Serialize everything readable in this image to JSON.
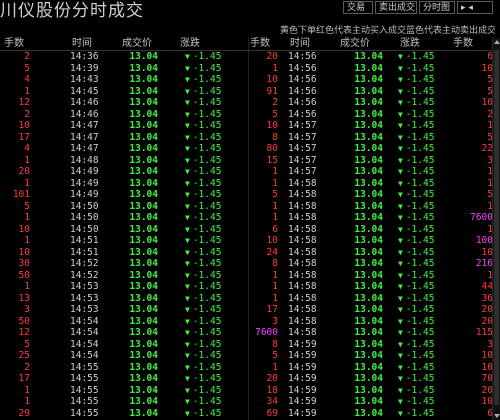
{
  "title": "川仪股份分时成交",
  "toolbar": {
    "btn1": "交易",
    "btn2": "卖出成交",
    "btn3": "分时图",
    "btn4": ""
  },
  "legend": "黄色下单红色代表主动买入成交蓝色代表主动卖出成交粉色为大单",
  "headers": {
    "left": [
      "手数",
      "时间",
      "成交价",
      "涨跌"
    ],
    "right": [
      "手数",
      "时间",
      "成交价",
      "涨跌",
      "手数"
    ]
  },
  "colors": {
    "up": "#ff3b3b",
    "down": "#3ff23f",
    "big": "#ff3bff",
    "bg": "#000000"
  },
  "left_rows": [
    {
      "vol": "2",
      "vc": "red",
      "time": "14:36",
      "price": "13.04",
      "chg": "-1.45"
    },
    {
      "vol": "5",
      "vc": "red",
      "time": "14:39",
      "price": "13.04",
      "chg": "-1.45"
    },
    {
      "vol": "4",
      "vc": "red",
      "time": "14:43",
      "price": "13.04",
      "chg": "-1.45"
    },
    {
      "vol": "1",
      "vc": "red",
      "time": "14:45",
      "price": "13.04",
      "chg": "-1.45"
    },
    {
      "vol": "12",
      "vc": "red",
      "time": "14:46",
      "price": "13.04",
      "chg": "-1.45"
    },
    {
      "vol": "2",
      "vc": "red",
      "time": "14:46",
      "price": "13.04",
      "chg": "-1.45"
    },
    {
      "vol": "10",
      "vc": "red",
      "time": "14:47",
      "price": "13.04",
      "chg": "-1.45"
    },
    {
      "vol": "17",
      "vc": "red",
      "time": "14:47",
      "price": "13.04",
      "chg": "-1.45"
    },
    {
      "vol": "4",
      "vc": "red",
      "time": "14:47",
      "price": "13.04",
      "chg": "-1.45"
    },
    {
      "vol": "1",
      "vc": "red",
      "time": "14:48",
      "price": "13.04",
      "chg": "-1.45"
    },
    {
      "vol": "20",
      "vc": "red",
      "time": "14:49",
      "price": "13.04",
      "chg": "-1.45"
    },
    {
      "vol": "1",
      "vc": "red",
      "time": "14:49",
      "price": "13.04",
      "chg": "-1.45"
    },
    {
      "vol": "101",
      "vc": "red",
      "time": "14:49",
      "price": "13.04",
      "chg": "-1.45"
    },
    {
      "vol": "5",
      "vc": "red",
      "time": "14:50",
      "price": "13.04",
      "chg": "-1.45"
    },
    {
      "vol": "1",
      "vc": "red",
      "time": "14:50",
      "price": "13.04",
      "chg": "-1.45"
    },
    {
      "vol": "10",
      "vc": "red",
      "time": "14:50",
      "price": "13.04",
      "chg": "-1.45"
    },
    {
      "vol": "1",
      "vc": "red",
      "time": "14:51",
      "price": "13.04",
      "chg": "-1.45"
    },
    {
      "vol": "10",
      "vc": "red",
      "time": "14:51",
      "price": "13.04",
      "chg": "-1.45"
    },
    {
      "vol": "30",
      "vc": "red",
      "time": "14:52",
      "price": "13.04",
      "chg": "-1.45"
    },
    {
      "vol": "50",
      "vc": "red",
      "time": "14:52",
      "price": "13.04",
      "chg": "-1.45"
    },
    {
      "vol": "1",
      "vc": "red",
      "time": "14:53",
      "price": "13.04",
      "chg": "-1.45"
    },
    {
      "vol": "13",
      "vc": "red",
      "time": "14:53",
      "price": "13.04",
      "chg": "-1.45"
    },
    {
      "vol": "3",
      "vc": "red",
      "time": "14:53",
      "price": "13.04",
      "chg": "-1.45"
    },
    {
      "vol": "50",
      "vc": "red",
      "time": "14:54",
      "price": "13.04",
      "chg": "-1.45"
    },
    {
      "vol": "12",
      "vc": "red",
      "time": "14:54",
      "price": "13.04",
      "chg": "-1.45"
    },
    {
      "vol": "5",
      "vc": "red",
      "time": "14:54",
      "price": "13.04",
      "chg": "-1.45"
    },
    {
      "vol": "25",
      "vc": "red",
      "time": "14:54",
      "price": "13.04",
      "chg": "-1.45"
    },
    {
      "vol": "2",
      "vc": "red",
      "time": "14:55",
      "price": "13.04",
      "chg": "-1.45"
    },
    {
      "vol": "17",
      "vc": "red",
      "time": "14:55",
      "price": "13.04",
      "chg": "-1.45"
    },
    {
      "vol": "1",
      "vc": "red",
      "time": "14:55",
      "price": "13.04",
      "chg": "-1.45"
    },
    {
      "vol": "1",
      "vc": "red",
      "time": "14:55",
      "price": "13.04",
      "chg": "-1.45"
    },
    {
      "vol": "29",
      "vc": "red",
      "time": "14:55",
      "price": "13.04",
      "chg": "-1.45"
    }
  ],
  "right_rows": [
    {
      "n": "20",
      "nc": "red",
      "time": "14:56",
      "price": "13.04",
      "chg": "-1.45",
      "vol": "6",
      "vc": "red"
    },
    {
      "n": "1",
      "nc": "red",
      "time": "14:56",
      "price": "13.04",
      "chg": "-1.45",
      "vol": "10",
      "vc": "red"
    },
    {
      "n": "10",
      "nc": "red",
      "time": "14:56",
      "price": "13.04",
      "chg": "-1.45",
      "vol": "5",
      "vc": "red"
    },
    {
      "n": "91",
      "nc": "red",
      "time": "14:56",
      "price": "13.04",
      "chg": "-1.45",
      "vol": "5",
      "vc": "red"
    },
    {
      "n": "2",
      "nc": "red",
      "time": "14:56",
      "price": "13.04",
      "chg": "-1.45",
      "vol": "10",
      "vc": "red"
    },
    {
      "n": "5",
      "nc": "red",
      "time": "14:56",
      "price": "13.04",
      "chg": "-1.45",
      "vol": "2",
      "vc": "red"
    },
    {
      "n": "10",
      "nc": "red",
      "time": "14:57",
      "price": "13.04",
      "chg": "-1.45",
      "vol": "1",
      "vc": "red"
    },
    {
      "n": "8",
      "nc": "red",
      "time": "14:57",
      "price": "13.04",
      "chg": "-1.45",
      "vol": "5",
      "vc": "red"
    },
    {
      "n": "80",
      "nc": "red",
      "time": "14:57",
      "price": "13.04",
      "chg": "-1.45",
      "vol": "22",
      "vc": "red"
    },
    {
      "n": "15",
      "nc": "red",
      "time": "14:57",
      "price": "13.04",
      "chg": "-1.45",
      "vol": "3",
      "vc": "red"
    },
    {
      "n": "1",
      "nc": "red",
      "time": "14:57",
      "price": "13.04",
      "chg": "-1.45",
      "vol": "1",
      "vc": "red"
    },
    {
      "n": "1",
      "nc": "red",
      "time": "14:58",
      "price": "13.04",
      "chg": "-1.45",
      "vol": "1",
      "vc": "red"
    },
    {
      "n": "5",
      "nc": "red",
      "time": "14:58",
      "price": "13.04",
      "chg": "-1.45",
      "vol": "5",
      "vc": "red"
    },
    {
      "n": "1",
      "nc": "red",
      "time": "14:58",
      "price": "13.04",
      "chg": "-1.45",
      "vol": "1",
      "vc": "red"
    },
    {
      "n": "1",
      "nc": "red",
      "time": "14:58",
      "price": "13.04",
      "chg": "-1.45",
      "vol": "7600",
      "vc": "pink"
    },
    {
      "n": "6",
      "nc": "red",
      "time": "14:58",
      "price": "13.04",
      "chg": "-1.45",
      "vol": "1",
      "vc": "red"
    },
    {
      "n": "10",
      "nc": "red",
      "time": "14:58",
      "price": "13.04",
      "chg": "-1.45",
      "vol": "100",
      "vc": "pink"
    },
    {
      "n": "24",
      "nc": "red",
      "time": "14:58",
      "price": "13.04",
      "chg": "-1.45",
      "vol": "10",
      "vc": "red"
    },
    {
      "n": "8",
      "nc": "red",
      "time": "14:58",
      "price": "13.04",
      "chg": "-1.45",
      "vol": "216",
      "vc": "pink"
    },
    {
      "n": "1",
      "nc": "red",
      "time": "14:58",
      "price": "13.04",
      "chg": "-1.45",
      "vol": "1",
      "vc": "red"
    },
    {
      "n": "1",
      "nc": "red",
      "time": "14:58",
      "price": "13.04",
      "chg": "-1.45",
      "vol": "44",
      "vc": "red"
    },
    {
      "n": "1",
      "nc": "red",
      "time": "14:58",
      "price": "13.04",
      "chg": "-1.45",
      "vol": "36",
      "vc": "red"
    },
    {
      "n": "17",
      "nc": "red",
      "time": "14:58",
      "price": "13.04",
      "chg": "-1.45",
      "vol": "20",
      "vc": "red"
    },
    {
      "n": "3",
      "nc": "red",
      "time": "14:58",
      "price": "13.04",
      "chg": "-1.45",
      "vol": "20",
      "vc": "red"
    },
    {
      "n": "7600",
      "nc": "pink",
      "time": "14:58",
      "price": "13.04",
      "chg": "-1.45",
      "vol": "115",
      "vc": "red"
    },
    {
      "n": "8",
      "nc": "red",
      "time": "14:59",
      "price": "13.04",
      "chg": "-1.45",
      "vol": "3",
      "vc": "red"
    },
    {
      "n": "5",
      "nc": "red",
      "time": "14:59",
      "price": "13.04",
      "chg": "-1.45",
      "vol": "10",
      "vc": "red"
    },
    {
      "n": "1",
      "nc": "red",
      "time": "14:59",
      "price": "13.04",
      "chg": "-1.45",
      "vol": "10",
      "vc": "red"
    },
    {
      "n": "20",
      "nc": "red",
      "time": "14:59",
      "price": "13.04",
      "chg": "-1.45",
      "vol": "70",
      "vc": "red"
    },
    {
      "n": "18",
      "nc": "red",
      "time": "14:59",
      "price": "13.04",
      "chg": "-1.45",
      "vol": "20",
      "vc": "red"
    },
    {
      "n": "34",
      "nc": "red",
      "time": "14:59",
      "price": "13.04",
      "chg": "-1.45",
      "vol": "10",
      "vc": "red"
    },
    {
      "n": "69",
      "nc": "red",
      "time": "14:59",
      "price": "13.04",
      "chg": "-1.45",
      "vol": "6",
      "vc": "red"
    }
  ]
}
